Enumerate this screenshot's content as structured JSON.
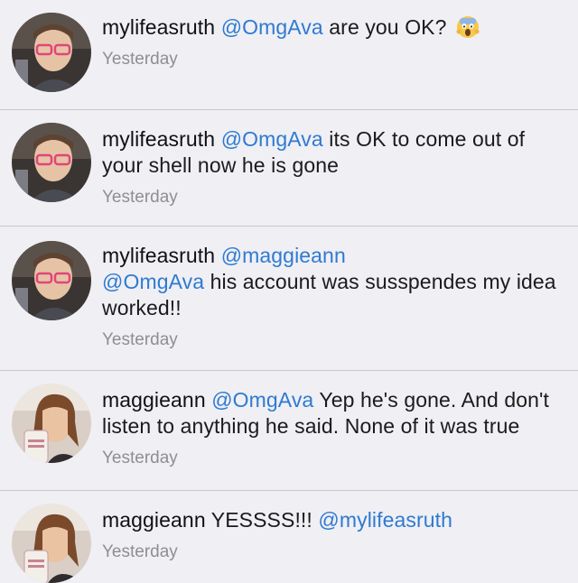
{
  "posts": [
    {
      "username": "mylifeasruth",
      "segments": [
        {
          "type": "mention",
          "text": "@OmgAva"
        },
        {
          "type": "text",
          "text": " are you OK? "
        }
      ],
      "emoji": "scream-emoji",
      "time": "Yesterday",
      "avatar": "ruth-avatar"
    },
    {
      "username": "mylifeasruth",
      "segments": [
        {
          "type": "mention",
          "text": "@OmgAva"
        },
        {
          "type": "text",
          "text": " its OK to come out of your shell now he is gone"
        }
      ],
      "time": "Yesterday",
      "avatar": "ruth-avatar"
    },
    {
      "username": "mylifeasruth",
      "segments": [
        {
          "type": "mention",
          "text": "@maggieann"
        },
        {
          "type": "break"
        },
        {
          "type": "mention",
          "text": "@OmgAva"
        },
        {
          "type": "text",
          "text": " his account was susspendes my idea worked!!"
        }
      ],
      "time": "Yesterday",
      "avatar": "ruth-avatar"
    },
    {
      "username": "maggieann",
      "segments": [
        {
          "type": "mention",
          "text": "@OmgAva"
        },
        {
          "type": "text",
          "text": " Yep he's gone. And don't listen to anything he said. None of it was true"
        }
      ],
      "time": "Yesterday",
      "avatar": "maggie-avatar"
    },
    {
      "username": "maggieann",
      "segments": [
        {
          "type": "text",
          "text": " YESSSS!!! "
        },
        {
          "type": "mention",
          "text": "@mylifeasruth"
        }
      ],
      "time": "Yesterday",
      "avatar": "maggie-avatar"
    }
  ],
  "colors": {
    "mention": "#2f7ad1",
    "timestamp": "#8e8e93",
    "background": "#efeff4",
    "divider": "#c8c7cc"
  }
}
